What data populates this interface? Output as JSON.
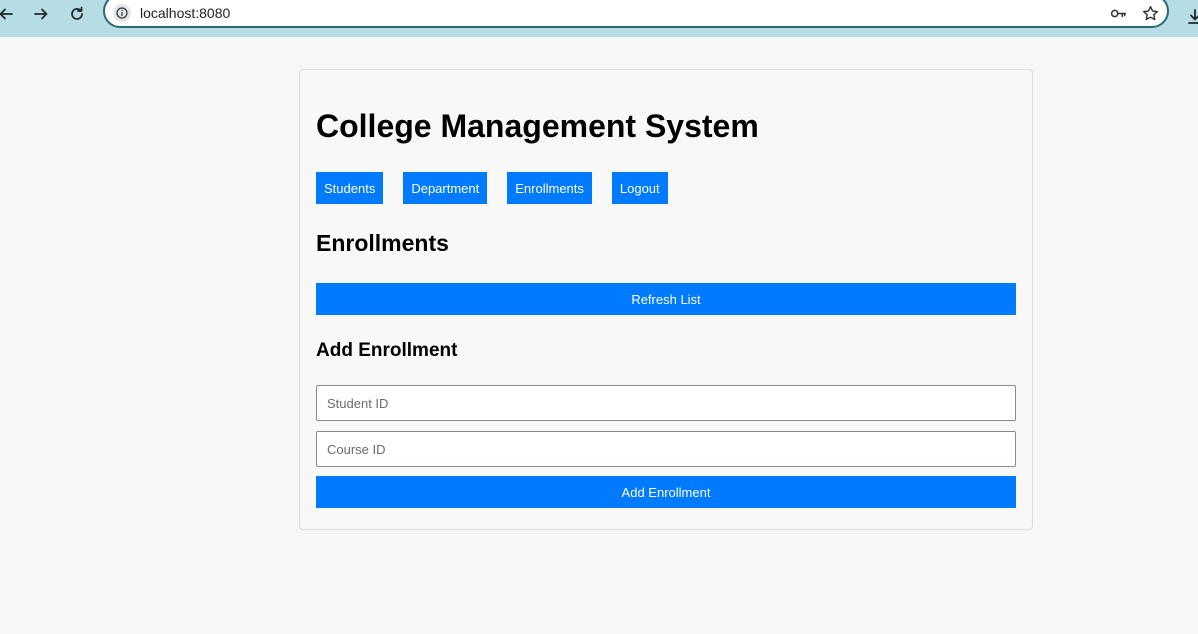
{
  "browser": {
    "url": "localhost:8080"
  },
  "header": {
    "title": "College Management System"
  },
  "nav": {
    "students": "Students",
    "department": "Department",
    "enrollments": "Enrollments",
    "logout": "Logout"
  },
  "enrollments": {
    "title": "Enrollments",
    "refresh_label": "Refresh List"
  },
  "add_enrollment": {
    "title": "Add Enrollment",
    "student_id_placeholder": "Student ID",
    "student_id_value": "",
    "course_id_placeholder": "Course ID",
    "course_id_value": "",
    "submit_label": "Add Enrollment"
  },
  "colors": {
    "accent": "#007bff",
    "chrome": "#b5dde3"
  },
  "icons": {
    "back": "back-arrow-icon",
    "forward": "forward-arrow-icon",
    "reload": "reload-icon",
    "site_info": "info-icon",
    "password": "key-icon",
    "bookmark": "star-icon"
  }
}
